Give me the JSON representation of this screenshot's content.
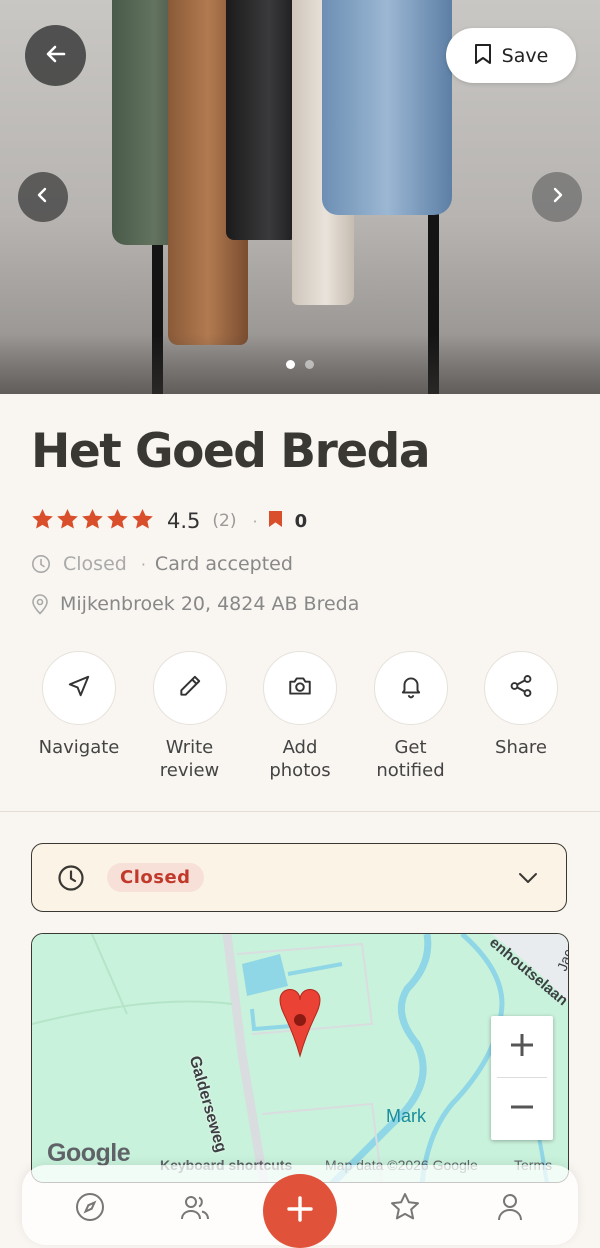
{
  "header": {
    "back_icon": "arrow-left-icon",
    "save_label": "Save",
    "save_icon": "bookmark-icon",
    "prev_icon": "chevron-left-icon",
    "next_icon": "chevron-right-icon",
    "photo_count": 2,
    "current_photo": 1
  },
  "place": {
    "name": "Het Goed Breda",
    "rating": "4.5",
    "rating_stars": 5,
    "review_count": "(2)",
    "separator": "·",
    "saved_count": "0",
    "status": "Closed",
    "payment": "Card accepted",
    "address": "Mijkenbroek 20, 4824 AB Breda"
  },
  "actions": [
    {
      "label": "Navigate",
      "icon": "navigate-arrow-icon"
    },
    {
      "label": "Write\nreview",
      "icon": "pencil-icon"
    },
    {
      "label": "Add\nphotos",
      "icon": "camera-icon"
    },
    {
      "label": "Get\nnotified",
      "icon": "bell-icon"
    },
    {
      "label": "Share",
      "icon": "share-icon"
    }
  ],
  "hours": {
    "status": "Closed",
    "icon": "clock-icon",
    "expand_icon": "chevron-down-icon"
  },
  "map": {
    "street_label": "Galderseweg",
    "street_label_2": "enhoutselaan",
    "street_label_3": "Jac",
    "water_label": "Mark",
    "zoom_in": "+",
    "zoom_out": "−",
    "logo": "Google",
    "keyboard_shortcuts": "Keyboard shortcuts",
    "map_data": "Map data ©2026 Google",
    "terms": "Terms"
  },
  "bottom_nav": [
    {
      "icon": "compass-icon"
    },
    {
      "icon": "people-icon"
    },
    {
      "icon": "plus-icon"
    },
    {
      "icon": "star-icon"
    },
    {
      "icon": "profile-icon"
    }
  ],
  "colors": {
    "accent": "#e0533a",
    "star": "#d94f2b",
    "background": "#f9f6f2",
    "map_green": "#c9f2dc",
    "map_water": "#8fd6e6"
  }
}
